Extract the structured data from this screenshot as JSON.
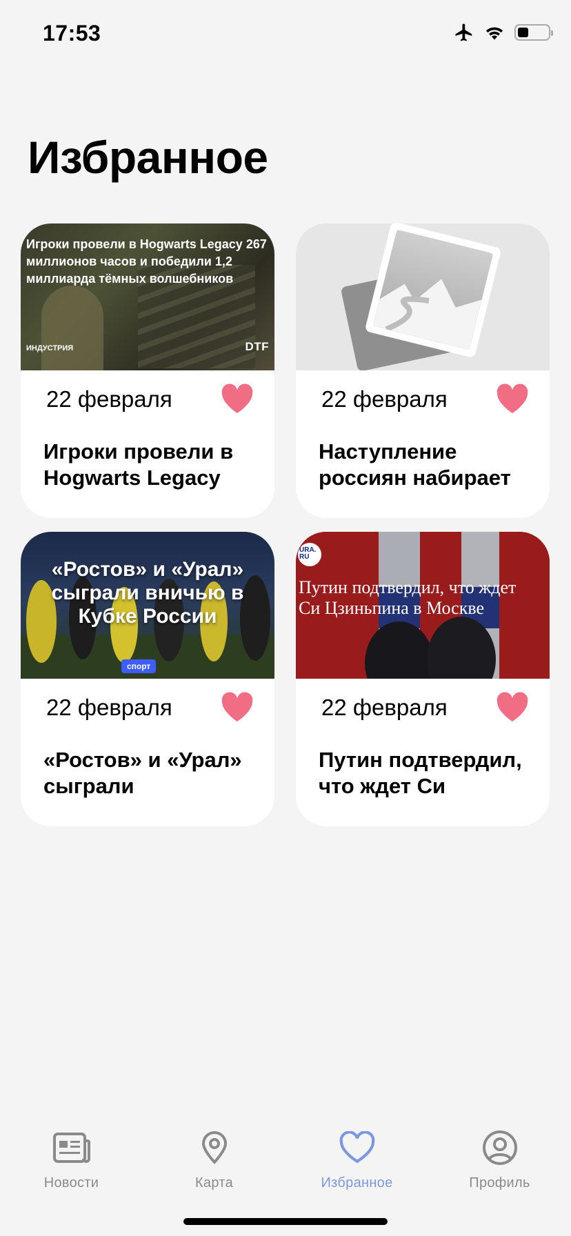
{
  "status_bar": {
    "time": "17:53"
  },
  "page": {
    "title": "Избранное"
  },
  "accent": {
    "heart": "#f06d84",
    "active_tab": "#7a97e0"
  },
  "cards": [
    {
      "date": "22 февраля",
      "title": "Игроки провели в Hogwarts Legacy",
      "image": {
        "overlay_text": "Игроки провели в Hogwarts Legacy 267 миллионов часов и победили 1,2 миллиарда тёмных волшебников",
        "tag": "ИНДУСТРИЯ",
        "brand": "DTF"
      }
    },
    {
      "date": "22 февраля",
      "title": "Наступление россиян набирает",
      "image": {
        "placeholder_icon": "image-placeholder-icon"
      }
    },
    {
      "date": "22 февраля",
      "title": "«Ростов» и «Урал» сыграли",
      "image": {
        "overlay_text": "«Ростов» и «Урал» сыграли вничью в Кубке России",
        "badge": "спорт"
      }
    },
    {
      "date": "22 февраля",
      "title": "Путин подтвердил, что ждет Си",
      "image": {
        "overlay_text": "Путин подтвердил, что ждет Си Цзиньпина в Москве",
        "logo": "URA. RU"
      }
    }
  ],
  "tabs": [
    {
      "label": "Новости",
      "icon": "newspaper-icon",
      "active": false
    },
    {
      "label": "Карта",
      "icon": "map-pin-icon",
      "active": false
    },
    {
      "label": "Избранное",
      "icon": "heart-icon",
      "active": true
    },
    {
      "label": "Профиль",
      "icon": "profile-icon",
      "active": false
    }
  ]
}
